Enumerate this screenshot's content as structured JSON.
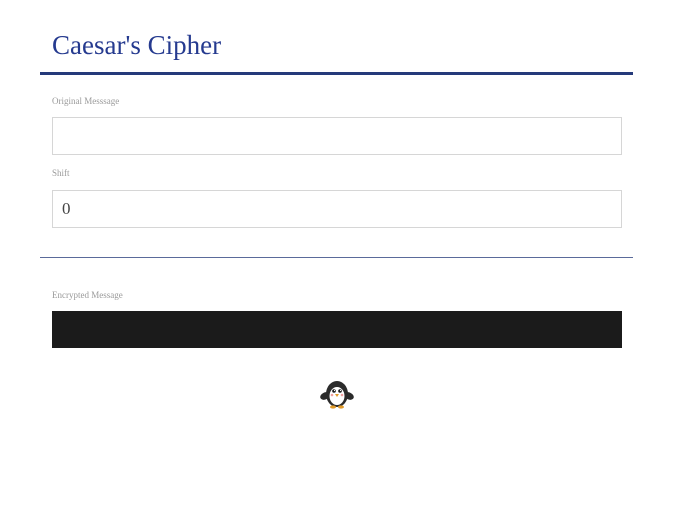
{
  "header": {
    "title": "Caesar's Cipher"
  },
  "form": {
    "original_label": "Original Messsage",
    "original_value": "",
    "shift_label": "Shift",
    "shift_value": "0"
  },
  "result": {
    "label": "Encrypted Message",
    "value": ""
  },
  "footer": {
    "icon": "penguin-icon"
  },
  "colors": {
    "title": "#253a8f",
    "rule": "#253a7a",
    "output_background": "#1b1b1b"
  }
}
